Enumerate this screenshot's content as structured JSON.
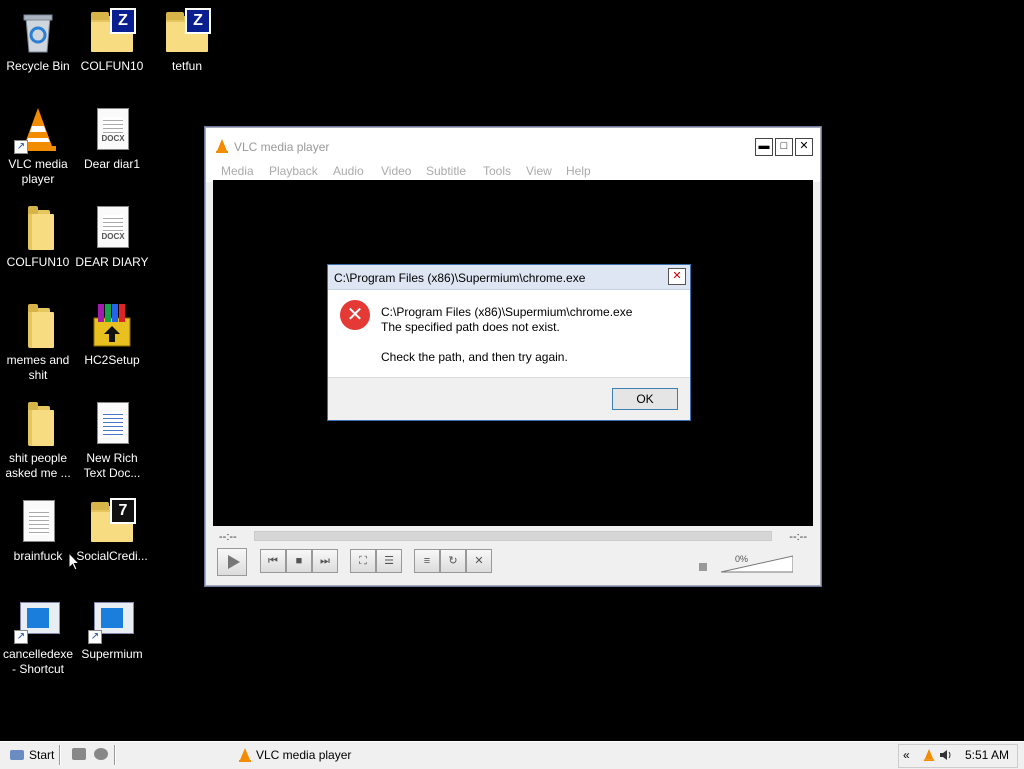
{
  "desktop": {
    "icons": [
      {
        "label": "Recycle Bin"
      },
      {
        "label": "COLFUN10"
      },
      {
        "label": "tetfun"
      },
      {
        "label": "VLC media player"
      },
      {
        "label": "Dear diar1"
      },
      {
        "label": "COLFUN10"
      },
      {
        "label": "DEAR DIARY"
      },
      {
        "label": "memes and shit"
      },
      {
        "label": "HC2Setup"
      },
      {
        "label": "shit people asked me ..."
      },
      {
        "label": "New Rich Text Doc..."
      },
      {
        "label": "brainfuck"
      },
      {
        "label": "SocialCredi..."
      },
      {
        "label": "cancelledexe - Shortcut"
      },
      {
        "label": "Supermium"
      }
    ],
    "doc_tag": "DOCX"
  },
  "vlc": {
    "title": "VLC media player",
    "menu": [
      "Media",
      "Playback",
      "Audio",
      "Video",
      "Subtitle",
      "Tools",
      "View",
      "Help"
    ],
    "time_elapsed": "--:--",
    "time_total": "--:--",
    "volume": "0%",
    "volume_level": 0
  },
  "dialog": {
    "title": "C:\\Program Files (x86)\\Supermium\\chrome.exe",
    "line1": "C:\\Program Files (x86)\\Supermium\\chrome.exe",
    "line2": "The specified path does not exist.",
    "line3": "Check the path, and then try again.",
    "ok": "OK"
  },
  "taskbar": {
    "start": "Start",
    "task": "VLC media player",
    "tray_chevron": "«",
    "clock": "5:51 AM"
  },
  "colors": {
    "accent": "#3a6fb0",
    "error": "#e53935",
    "vlc_orange": "#f28c00"
  }
}
